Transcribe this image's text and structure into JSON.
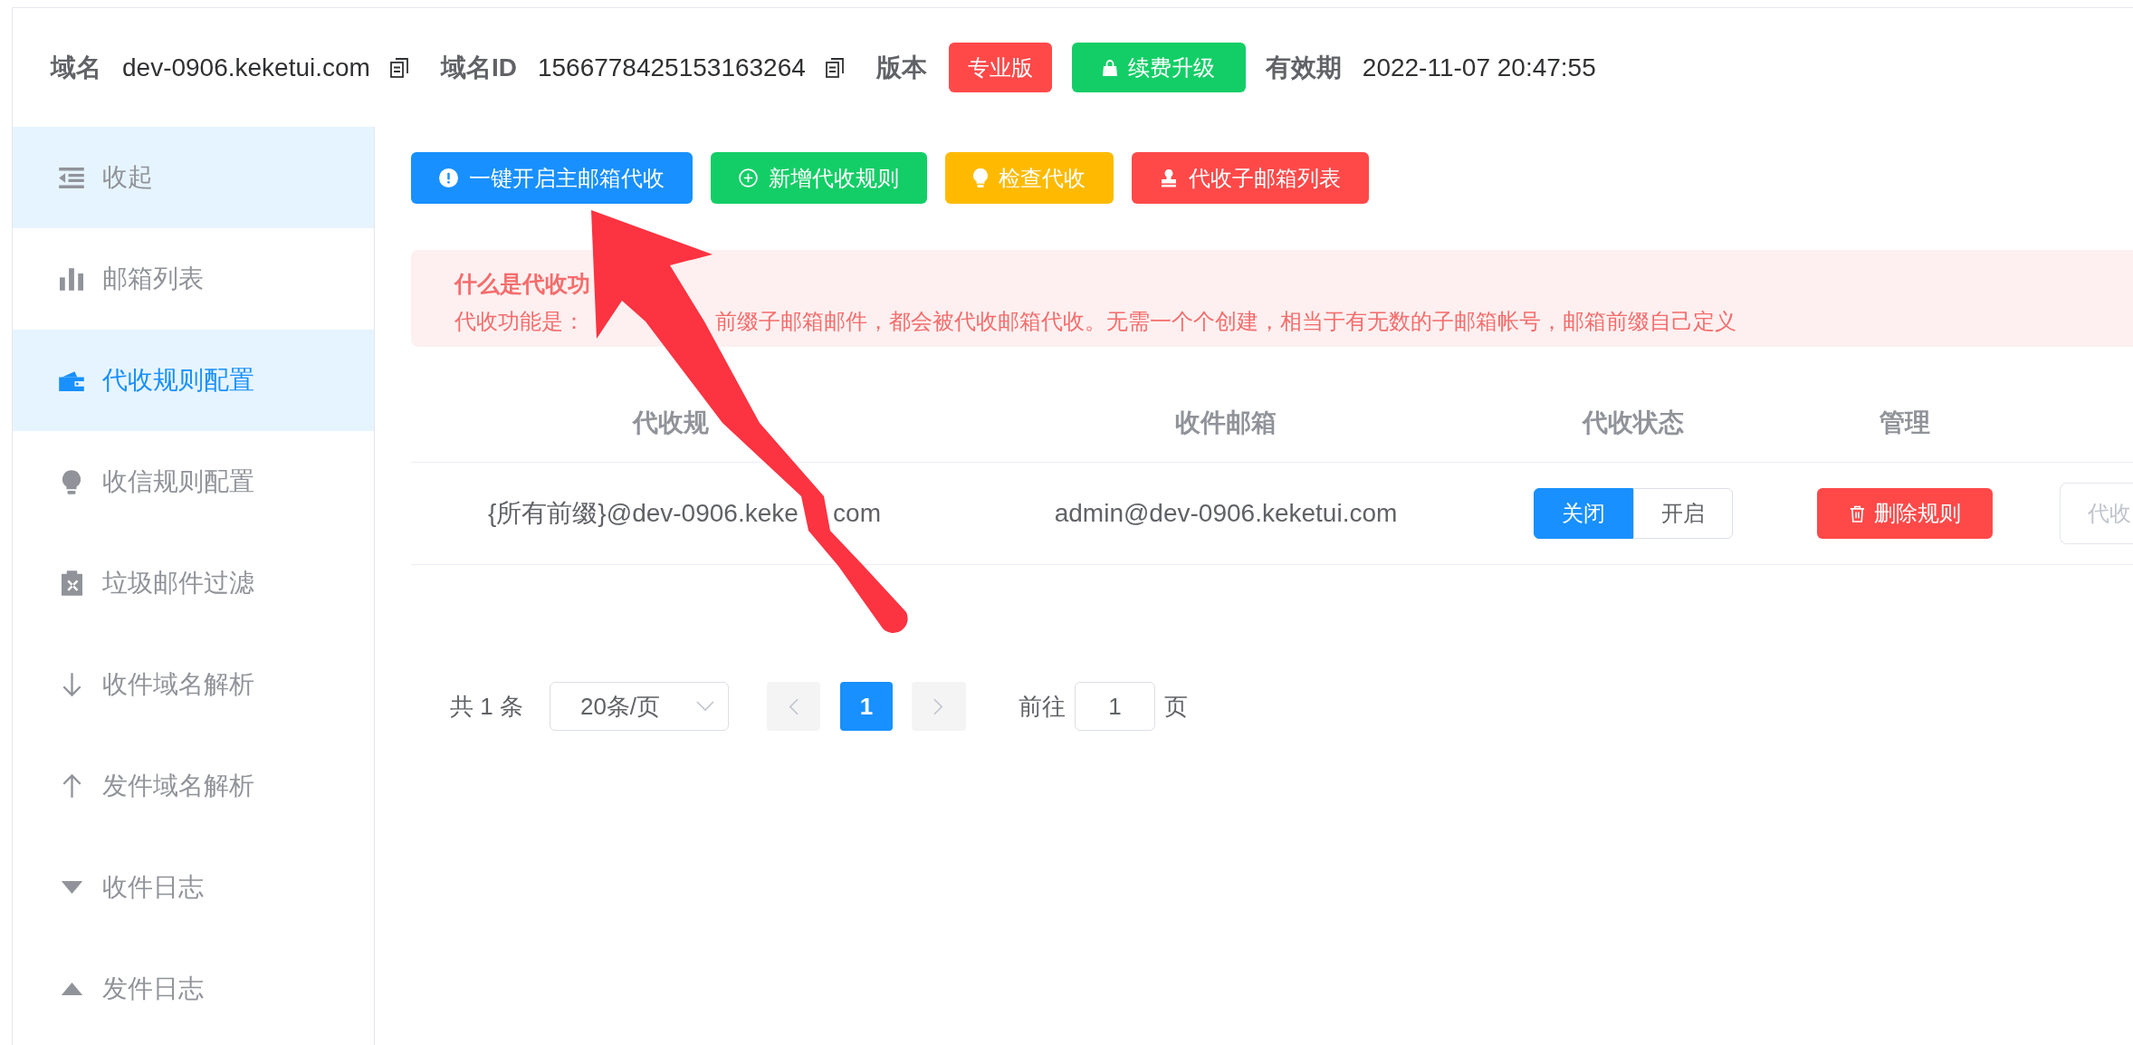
{
  "header": {
    "fields": [
      {
        "kind": "copyable",
        "label": "域名",
        "value": "dev-0906.keketui.com"
      },
      {
        "kind": "copyable",
        "label": "域名ID",
        "value": "1566778425153163264"
      },
      {
        "kind": "badge",
        "label": "版本",
        "value": "专业版"
      },
      {
        "kind": "button",
        "value": "续费升级"
      },
      {
        "kind": "text",
        "label": "有效期",
        "value": "2022-11-07 20:47:55"
      }
    ]
  },
  "sidebar": {
    "collapse": "收起",
    "items": [
      {
        "label": "邮箱列表",
        "selected": false
      },
      {
        "label": "代收规则配置",
        "selected": true
      },
      {
        "label": "收信规则配置",
        "selected": false
      },
      {
        "label": "垃圾邮件过滤",
        "selected": false
      },
      {
        "label": "收件域名解析",
        "selected": false
      },
      {
        "label": "发件域名解析",
        "selected": false
      },
      {
        "label": "收件日志",
        "selected": false
      },
      {
        "label": "发件日志",
        "selected": false
      }
    ]
  },
  "toolbar": [
    {
      "kind": "primary",
      "label": "一键开启主邮箱代收"
    },
    {
      "kind": "success",
      "label": "新增代收规则"
    },
    {
      "kind": "warning",
      "label": "检查代收"
    },
    {
      "kind": "danger",
      "label": "代收子邮箱列表"
    }
  ],
  "alert": {
    "title": "什么是代收功",
    "text_parts": [
      "代收功能是：",
      "前缀子邮箱邮件，都会被代收邮箱代收。无需一个个创建，相当于有无数的子邮箱帐号，邮箱前缀自己定义"
    ]
  },
  "table": {
    "columns": [
      "代收规",
      "收件邮箱",
      "代收状态",
      "管理"
    ],
    "rows": [
      {
        "rule_parts": [
          "{所有前缀}@dev-0906.keke",
          "com"
        ],
        "mailbox": "admin@dev-0906.keketui.com",
        "status_options": [
          {
            "label": "关闭",
            "selected": true
          },
          {
            "label": "开启",
            "selected": false
          }
        ],
        "delete_button": "删除规则",
        "extra_button": {
          "label": "代收",
          "disabled": true
        }
      }
    ]
  },
  "pagination": {
    "total": "共 1 条",
    "page_size": "20条/页",
    "prev": {
      "disabled": true
    },
    "pages": [
      {
        "label": "1",
        "selected": true
      }
    ],
    "next": {
      "disabled": true
    },
    "goto_label": "前往",
    "goto_value": "1",
    "goto_suffix": "页"
  }
}
